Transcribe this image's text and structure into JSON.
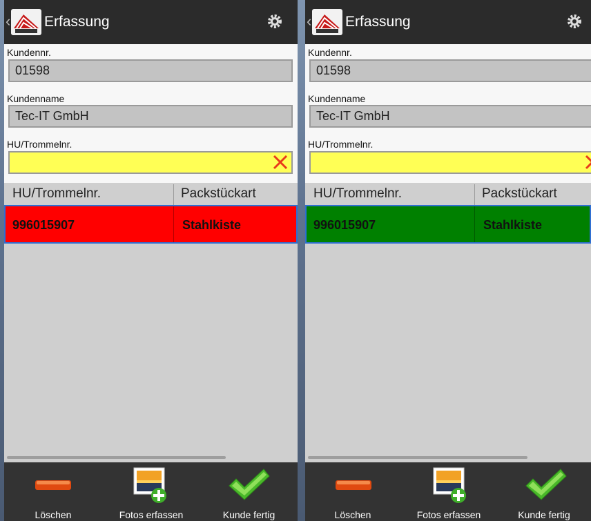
{
  "screens": [
    {
      "id": "left",
      "header": {
        "title": "Erfassung"
      },
      "form": {
        "customer_no_label": "Kundennr.",
        "customer_no_value": "01598",
        "customer_name_label": "Kundenname",
        "customer_name_value": "Tec-IT GmbH",
        "hu_label": "HU/Trommelnr.",
        "hu_value": ""
      },
      "table": {
        "columns": [
          "HU/Trommelnr.",
          "Packstückart"
        ],
        "rows": [
          {
            "hu": "996015907",
            "type": "Stahlkiste",
            "status_color": "#ff0000"
          }
        ]
      },
      "actions": {
        "delete_label": "Löschen",
        "photos_label": "Fotos erfassen",
        "done_label": "Kunde fertig"
      }
    },
    {
      "id": "right",
      "header": {
        "title": "Erfassung"
      },
      "form": {
        "customer_no_label": "Kundennr.",
        "customer_no_value": "01598",
        "customer_name_label": "Kundenname",
        "customer_name_value": "Tec-IT GmbH",
        "hu_label": "HU/Trommelnr.",
        "hu_value": ""
      },
      "table": {
        "columns": [
          "HU/Trommelnr.",
          "Packstückart"
        ],
        "rows": [
          {
            "hu": "996015907",
            "type": "Stahlkiste",
            "status_color": "#008000"
          }
        ]
      },
      "actions": {
        "delete_label": "Löschen",
        "photos_label": "Fotos erfassen",
        "done_label": "Kunde fertig"
      }
    }
  ],
  "colors": {
    "highlight": "#ffff55",
    "selection_border": "#2f6fd1"
  },
  "icons": [
    "app-logo-icon",
    "settings-gear-icon",
    "clear-x-icon",
    "minus-icon",
    "add-photo-icon",
    "checkmark-icon"
  ]
}
